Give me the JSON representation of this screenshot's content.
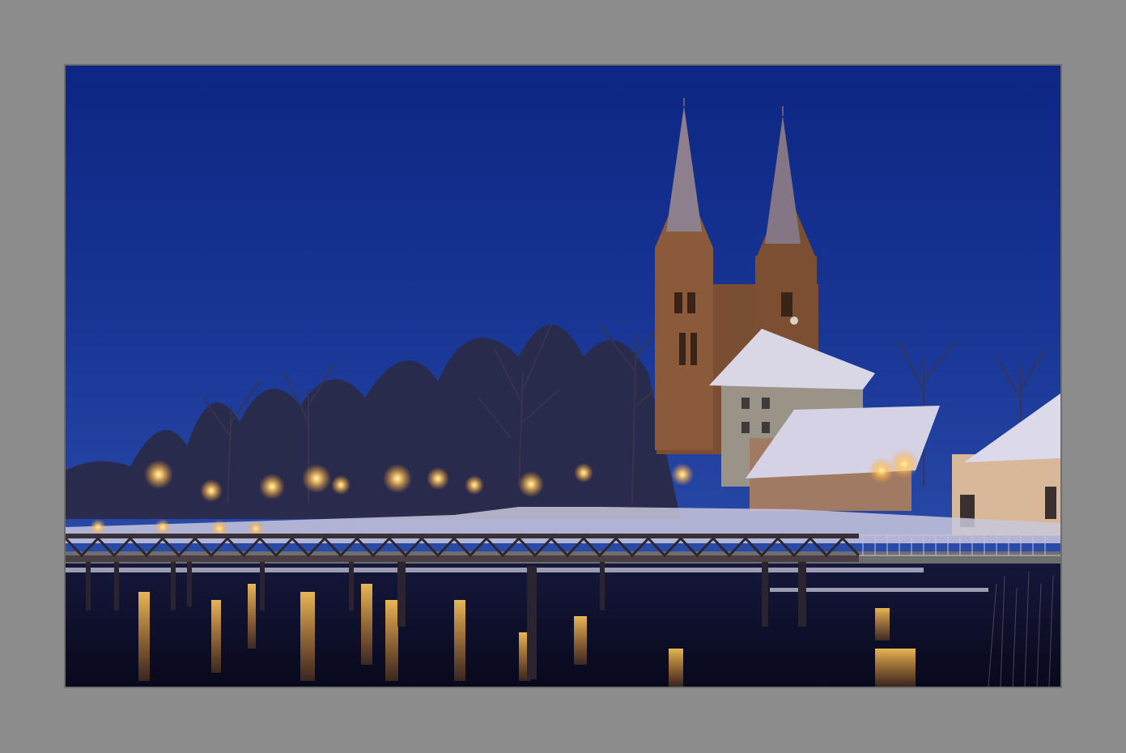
{
  "frame": {
    "mat_color": "#8c8c8c",
    "subject": "framed-night-photo"
  },
  "photo": {
    "scene": "winter-night-waterfront-church",
    "colors": {
      "sky_top": "#0f2a86",
      "sky_bottom": "#1e3c9a",
      "brick": "#8a5a3a",
      "brick_dark": "#5e3a26",
      "snow": "#d8d6e8",
      "lamp": "#ffd27a",
      "water": "#0e0f2a"
    }
  }
}
